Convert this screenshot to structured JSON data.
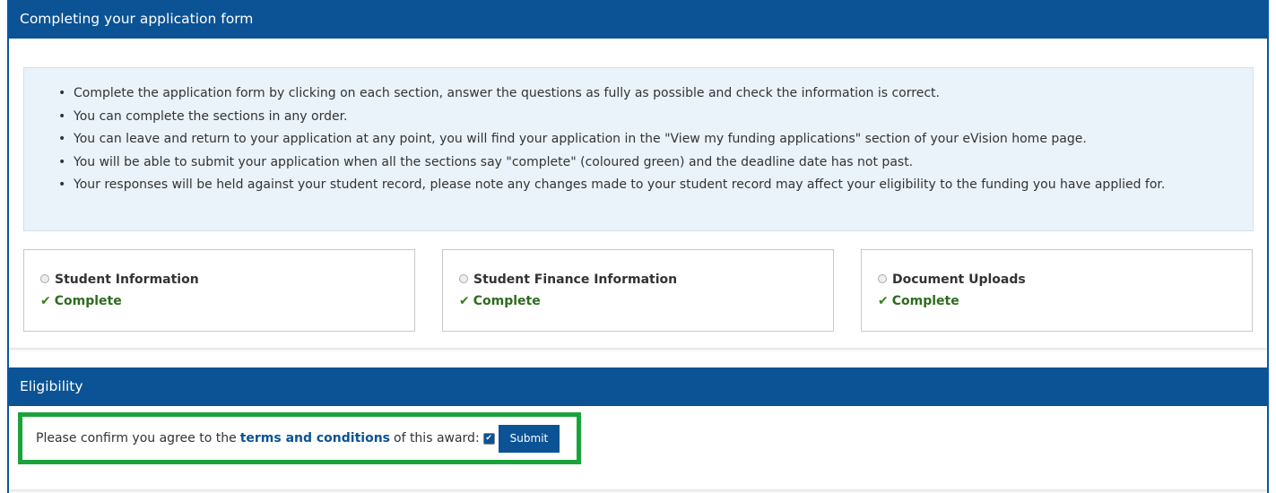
{
  "panel1": {
    "title": "Completing your application form",
    "bullets": [
      "Complete the application form by clicking on each section, answer the questions as fully as possible and check the information is correct.",
      "You can complete the sections in any order.",
      "You can leave and return to your application at any point, you will find your application in the \"View my funding applications\" section of your eVision home page.",
      "You will be able to submit your application when all the sections say \"complete\" (coloured green) and the deadline date has not past.",
      "Your responses will be held against your student record, please note any changes made to your student record may affect your eligibility to the funding you have applied for."
    ],
    "sections": [
      {
        "title": "Student Information",
        "status": "Complete"
      },
      {
        "title": "Student Finance Information",
        "status": "Complete"
      },
      {
        "title": "Document Uploads",
        "status": "Complete"
      }
    ]
  },
  "panel2": {
    "title": "Eligibility",
    "confirm_prefix": "Please confirm you agree to the",
    "terms_link": "terms and conditions",
    "confirm_suffix": "of this award:",
    "submit_label": "Submit"
  },
  "colors": {
    "header_bg": "#0b5394",
    "info_bg": "#eaf3fa",
    "complete_green": "#2e6b1f",
    "highlight_border": "#1aa33a"
  },
  "icons": {
    "bullet": "bullet-icon",
    "radio": "radio-icon",
    "check": "checkmark-icon",
    "checkbox": "checkbox-checked-icon"
  }
}
